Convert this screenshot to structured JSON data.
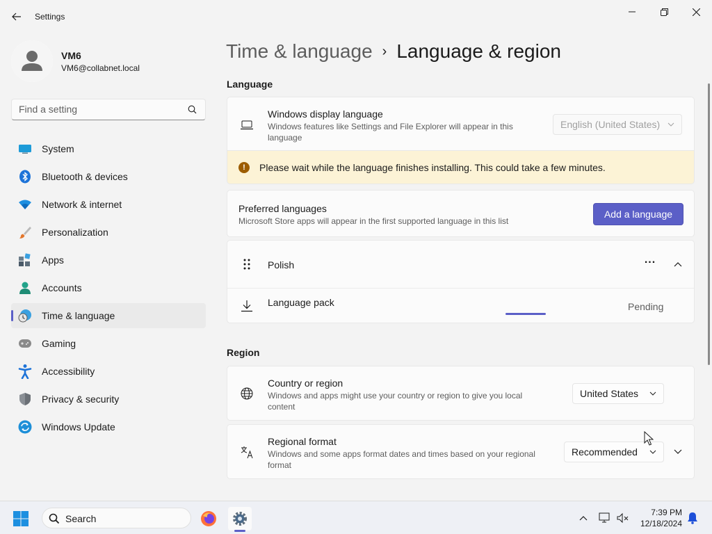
{
  "window": {
    "title": "Settings",
    "controls": {
      "minimize": "minimize",
      "maximize": "restore",
      "close": "close"
    }
  },
  "user": {
    "name": "VM6",
    "email": "VM6@collabnet.local"
  },
  "search": {
    "placeholder": "Find a setting"
  },
  "nav": {
    "items": [
      {
        "label": "System",
        "icon": "system-icon"
      },
      {
        "label": "Bluetooth & devices",
        "icon": "bluetooth-icon"
      },
      {
        "label": "Network & internet",
        "icon": "wifi-icon"
      },
      {
        "label": "Personalization",
        "icon": "brush-icon"
      },
      {
        "label": "Apps",
        "icon": "apps-icon"
      },
      {
        "label": "Accounts",
        "icon": "accounts-icon"
      },
      {
        "label": "Time & language",
        "icon": "time-language-icon",
        "active": true
      },
      {
        "label": "Gaming",
        "icon": "gamepad-icon"
      },
      {
        "label": "Accessibility",
        "icon": "accessibility-icon"
      },
      {
        "label": "Privacy & security",
        "icon": "shield-icon"
      },
      {
        "label": "Windows Update",
        "icon": "update-icon"
      }
    ]
  },
  "breadcrumb": {
    "parent": "Time & language",
    "separator": "›",
    "current": "Language & region"
  },
  "language": {
    "section_title": "Language",
    "display_language": {
      "title": "Windows display language",
      "description_line1": "Windows features like Settings and File Explorer will appear in this",
      "description_line2": "language",
      "value": "English (United States)"
    },
    "warning": "Please wait while the language finishes installing. This could take a few minutes.",
    "preferred": {
      "title": "Preferred languages",
      "description": "Microsoft Store apps will appear in the first supported language in this list",
      "add_button": "Add a language"
    },
    "entries": [
      {
        "name": "Polish",
        "more": "...",
        "pack_label": "Language pack",
        "pack_status": "Pending",
        "pack_progress": 0.1
      }
    ]
  },
  "region": {
    "section_title": "Region",
    "country": {
      "title": "Country or region",
      "description_line1": "Windows and apps might use your country or region to give you local",
      "description_line2": "content",
      "value": "United States"
    },
    "format": {
      "title": "Regional format",
      "description_line1": "Windows and some apps format dates and times based on your regional",
      "description_line2": "format",
      "value": "Recommended"
    }
  },
  "taskbar": {
    "search_label": "Search",
    "time": "7:39 PM",
    "date": "12/18/2024"
  },
  "colors": {
    "accent": "#5b5fc7",
    "warning_bg": "#fcf3d6",
    "warning_icon": "#9d5d00"
  }
}
